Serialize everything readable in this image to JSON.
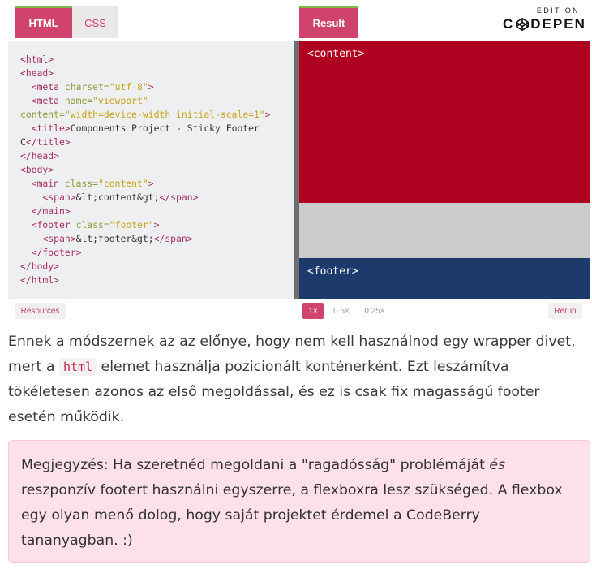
{
  "embed": {
    "tabs": {
      "html": "HTML",
      "css": "CSS",
      "result": "Result"
    },
    "logo": {
      "top": "EDIT ON",
      "main_left": "C",
      "main_right": "DEPEN",
      "glyph": "codepen-cube-icon"
    },
    "code_lines": [
      [
        {
          "c": "t",
          "s": "<html>"
        }
      ],
      [
        {
          "c": "t",
          "s": "<head>"
        }
      ],
      [
        {
          "c": "x",
          "s": "  "
        },
        {
          "c": "t",
          "s": "<meta "
        },
        {
          "c": "a",
          "s": "charset="
        },
        {
          "c": "v",
          "s": "\"utf-8\""
        },
        {
          "c": "t",
          "s": ">"
        }
      ],
      [
        {
          "c": "x",
          "s": "  "
        },
        {
          "c": "t",
          "s": "<meta "
        },
        {
          "c": "a",
          "s": "name="
        },
        {
          "c": "v",
          "s": "\"viewport\""
        }
      ],
      [
        {
          "c": "a",
          "s": "content="
        },
        {
          "c": "v",
          "s": "\"width=device-width initial-scale=1\""
        },
        {
          "c": "t",
          "s": ">"
        }
      ],
      [
        {
          "c": "x",
          "s": "  "
        },
        {
          "c": "t",
          "s": "<title>"
        },
        {
          "c": "x",
          "s": "Components Project - Sticky Footer"
        }
      ],
      [
        {
          "c": "x",
          "s": "C"
        },
        {
          "c": "t",
          "s": "</title>"
        }
      ],
      [
        {
          "c": "t",
          "s": "</head>"
        }
      ],
      [
        {
          "c": "t",
          "s": "<body>"
        }
      ],
      [
        {
          "c": "x",
          "s": "  "
        },
        {
          "c": "t",
          "s": "<main "
        },
        {
          "c": "a",
          "s": "class="
        },
        {
          "c": "v",
          "s": "\"content\""
        },
        {
          "c": "t",
          "s": ">"
        }
      ],
      [
        {
          "c": "x",
          "s": "    "
        },
        {
          "c": "t",
          "s": "<span>"
        },
        {
          "c": "x",
          "s": "&lt;content&gt;"
        },
        {
          "c": "t",
          "s": "</span>"
        }
      ],
      [
        {
          "c": "x",
          "s": "  "
        },
        {
          "c": "t",
          "s": "</main>"
        }
      ],
      [
        {
          "c": "x",
          "s": "  "
        },
        {
          "c": "t",
          "s": "<footer "
        },
        {
          "c": "a",
          "s": "class="
        },
        {
          "c": "v",
          "s": "\"footer\""
        },
        {
          "c": "t",
          "s": ">"
        }
      ],
      [
        {
          "c": "x",
          "s": "    "
        },
        {
          "c": "t",
          "s": "<span>"
        },
        {
          "c": "x",
          "s": "&lt;footer&gt;"
        },
        {
          "c": "t",
          "s": "</span>"
        }
      ],
      [
        {
          "c": "x",
          "s": "  "
        },
        {
          "c": "t",
          "s": "</footer>"
        }
      ],
      [
        {
          "c": "t",
          "s": "</body>"
        }
      ],
      [
        {
          "c": "t",
          "s": "</html>"
        }
      ]
    ],
    "result": {
      "content_label": "<content>",
      "footer_label": "<footer>"
    },
    "colors": {
      "accent": "#d0436c",
      "content_bg": "#b00020",
      "gap_bg": "#cbcbcb",
      "footer_bg": "#1d3a6d"
    },
    "bottom": {
      "resources": "Resources",
      "rerun": "Rerun",
      "zoom": [
        "1×",
        "0.5×",
        "0.25×"
      ]
    }
  },
  "article": {
    "p1_a": "Ennek a módszernek az az előnye, hogy nem kell használnod egy wrapper divet, mert a ",
    "p1_code": "html",
    "p1_b": " elemet használja pozicionált konténerként. Ezt leszámítva tökéletesen azonos az első megoldással, és ez is csak fix magasságú footer esetén működik.",
    "note_a": "Megjegyzés: Ha szeretnéd megoldani a \"ragadósság\" problémáját ",
    "note_em": "és",
    "note_b": " reszponzív footert használni egyszerre, a flexboxra lesz szükséged. A flexbox egy olyan menő dolog, hogy saját projektet érdemel a CodeBerry tananyagban. :)"
  }
}
